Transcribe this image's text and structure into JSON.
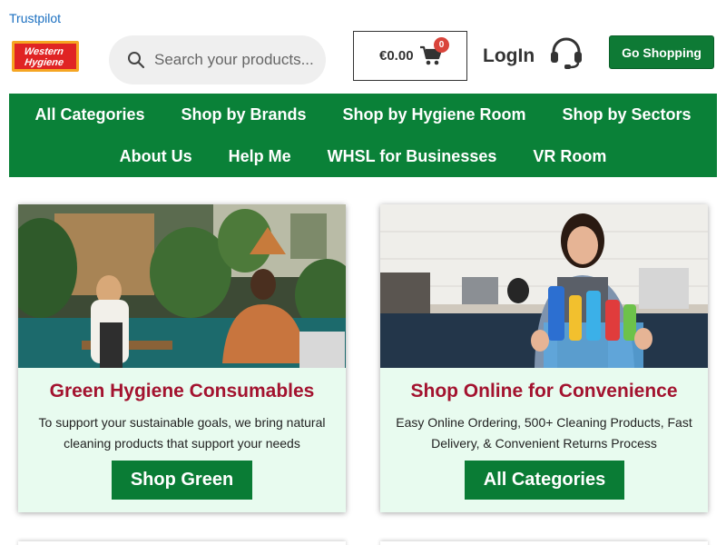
{
  "header": {
    "trustpilot": "Trustpilot",
    "logo_text_1": "Western",
    "logo_text_2": "Hygiene",
    "search_placeholder": "Search your products...",
    "cart_total": "€0.00",
    "cart_count": "0",
    "login": "LogIn",
    "go_shopping": "Go Shopping"
  },
  "nav": {
    "row1": [
      "All Categories",
      "Shop by Brands",
      "Shop by Hygiene Room",
      "Shop by Sectors"
    ],
    "row2": [
      "About Us",
      "Help Me",
      "WHSL for Businesses",
      "VR Room"
    ]
  },
  "cards": [
    {
      "title": "Green Hygiene Consumables",
      "text": "To support your sustainable goals, we bring natural cleaning products that support your needs",
      "button": "Shop Green"
    },
    {
      "title": "Shop Online for Convenience",
      "text": "Easy Online Ordering, 500+ Cleaning Products, Fast Delivery, & Convenient Returns Process",
      "button": "All Categories"
    }
  ],
  "colors": {
    "brand_green": "#0a8138",
    "title_red": "#a3132f",
    "card_bg": "#e8fbef",
    "badge_red": "#d9443b"
  }
}
